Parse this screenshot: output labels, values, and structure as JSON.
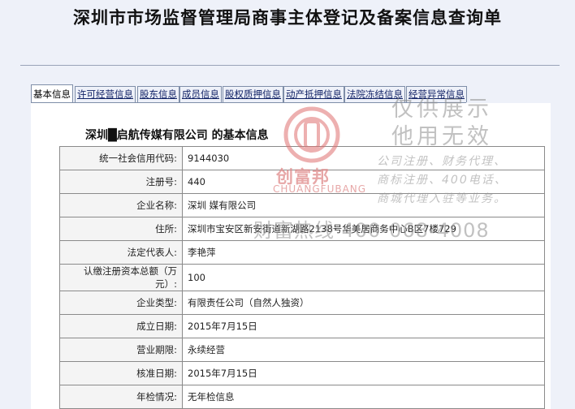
{
  "page": {
    "title": "深圳市市场监督管理局商事主体登记及备案信息查询单"
  },
  "tabs": [
    {
      "label": "基本信息",
      "active": true
    },
    {
      "label": "许可经营信息",
      "active": false
    },
    {
      "label": "股东信息",
      "active": false
    },
    {
      "label": "成员信息",
      "active": false
    },
    {
      "label": "股权质押信息",
      "active": false
    },
    {
      "label": "动产抵押信息",
      "active": false
    },
    {
      "label": "法院冻结信息",
      "active": false
    },
    {
      "label": "经营异常信息",
      "active": false
    }
  ],
  "company": {
    "heading": "深圳█启航传媒有限公司  的基本信息"
  },
  "rows": [
    {
      "label": "统一社会信用代码:",
      "value": "9144030"
    },
    {
      "label": "注册号:",
      "value": "440"
    },
    {
      "label": "企业名称:",
      "value": "深圳          媒有限公司"
    },
    {
      "label": "住所:",
      "value": "深圳市宝安区新安街道新湖路2138号华美居商务中心B区7楼729"
    },
    {
      "label": "法定代表人:",
      "value": "李艳萍"
    },
    {
      "label": "认缴注册资本总额（万元）:",
      "value": "100"
    },
    {
      "label": "企业类型:",
      "value": "有限责任公司（自然人独资）"
    },
    {
      "label": "成立日期:",
      "value": "2015年7月15日"
    },
    {
      "label": "营业期限:",
      "value": "永续经营"
    },
    {
      "label": "核准日期:",
      "value": "2015年7月15日"
    },
    {
      "label": "年检情况:",
      "value": "无年检信息"
    }
  ],
  "watermark": {
    "brand_cn": "创富邦",
    "brand_en": "CHUANGFUBANG",
    "notice_1": "仅供展示",
    "notice_2": "他用无效",
    "services_1": "公司注册、财务代理、",
    "services_2": "商标注册、400电话、",
    "services_3": "商城代理入驻等业务。",
    "hotline": "财富热线  400-068-4008",
    "logo_color": "#e07070"
  }
}
